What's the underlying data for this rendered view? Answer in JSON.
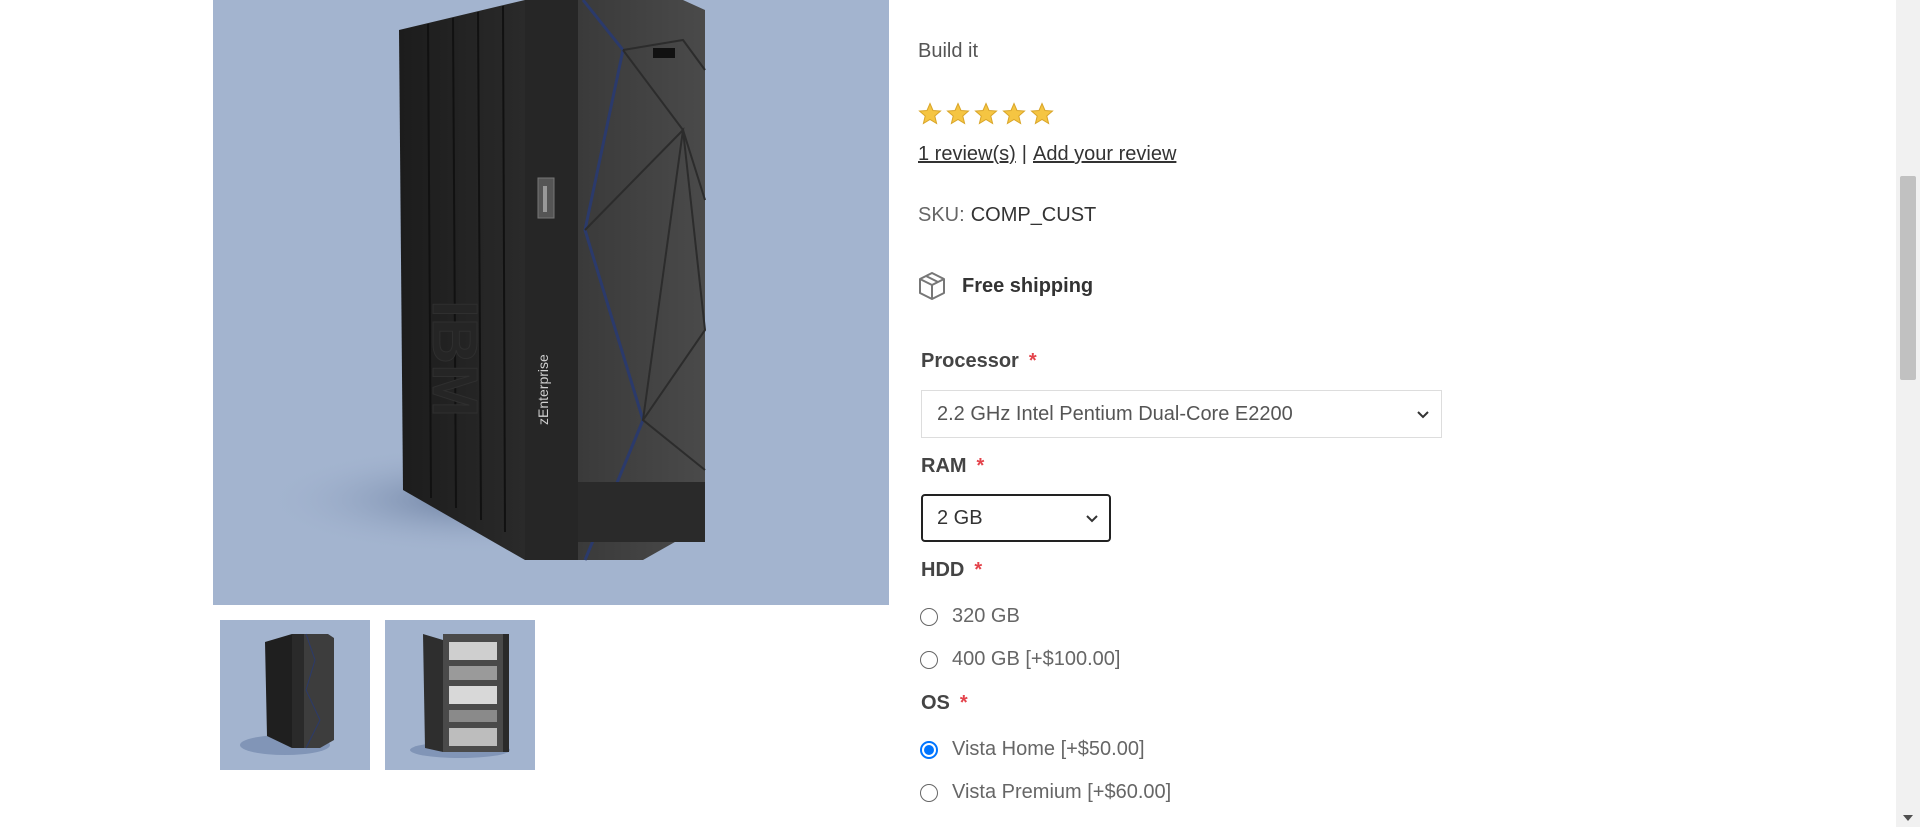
{
  "product": {
    "short_description": "Build it",
    "rating": 5,
    "rating_max": 5,
    "reviews_link": "1 review(s)",
    "separator": "|",
    "add_review_link": "Add your review",
    "sku_label": "SKU:",
    "sku_value": "COMP_CUST",
    "shipping_label": "Free shipping",
    "shipping_icon": "box-icon"
  },
  "gallery": {
    "main_image": "IBM z Enterprise server cabinet",
    "main_logo_text": "IBM",
    "main_side_text": "zEnterprise",
    "thumbnails": [
      "server-closed-thumbnail",
      "server-open-thumbnail"
    ]
  },
  "attributes": {
    "processor": {
      "label": "Processor",
      "required_mark": "*",
      "selected": "2.2 GHz Intel Pentium Dual-Core E2200"
    },
    "ram": {
      "label": "RAM",
      "required_mark": "*",
      "selected": "2 GB"
    },
    "hdd": {
      "label": "HDD",
      "required_mark": "*",
      "options": [
        "320 GB",
        "400 GB [+$100.00]"
      ],
      "selected_index": -1
    },
    "os": {
      "label": "OS",
      "required_mark": "*",
      "options": [
        "Vista Home [+$50.00]",
        "Vista Premium [+$60.00]"
      ],
      "selected_index": 0
    }
  },
  "colors": {
    "image_background": "#a3b4cf",
    "required": "#e4434b",
    "radio_checked": "#0075ff",
    "star": "#f5c542"
  }
}
